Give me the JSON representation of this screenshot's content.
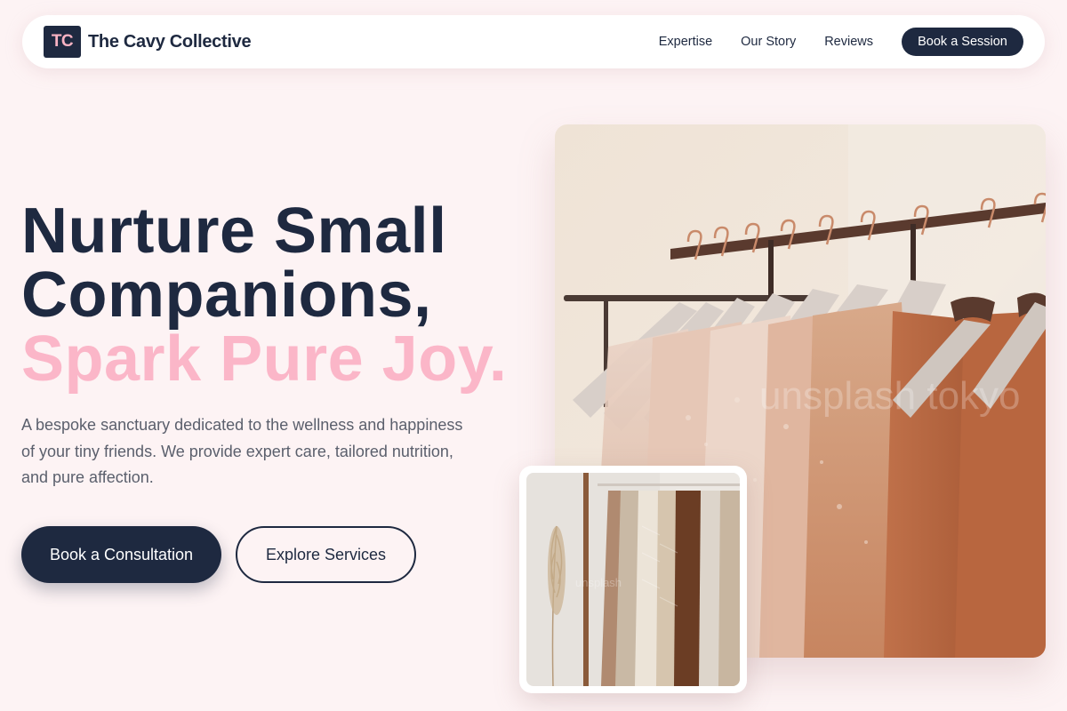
{
  "nav": {
    "logo_initials": "TC",
    "brand_name": "The Cavy Collective",
    "links": [
      "Expertise",
      "Our Story",
      "Reviews"
    ],
    "cta_label": "Book a Session"
  },
  "hero": {
    "title_line1": "Nurture Small",
    "title_line2": "Companions,",
    "title_accent": "Spark Pure Joy.",
    "description": "A bespoke sanctuary dedicated to the wellness and happiness of your tiny friends. We provide expert care, tailored nutrition, and pure affection.",
    "primary_button": "Book a Consultation",
    "secondary_button": "Explore Services"
  },
  "images": {
    "main_watermark": "unsplash tokyo",
    "inset_watermark": "unsplash"
  },
  "colors": {
    "navy": "#1e2940",
    "pink_accent": "#fbb6c8",
    "page_bg": "#fdf3f4"
  }
}
